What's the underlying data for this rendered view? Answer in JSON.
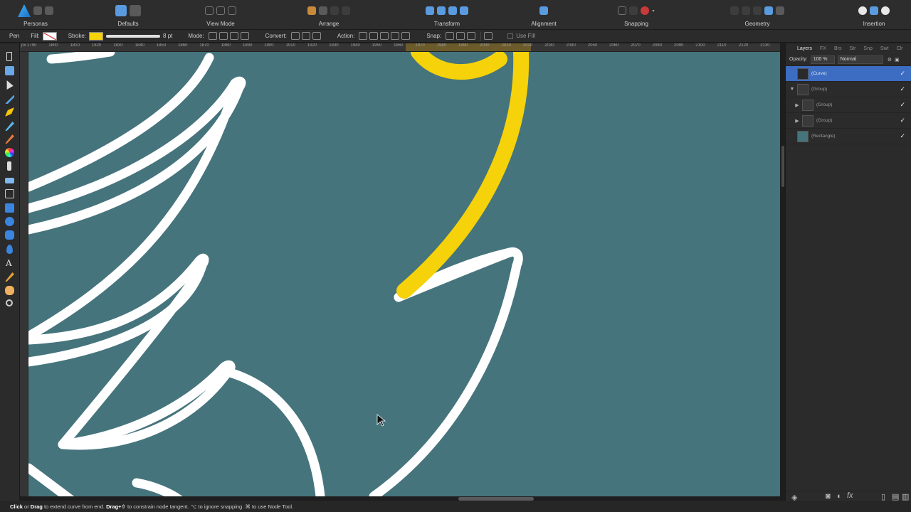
{
  "toolbar": {
    "personas_label": "Personas",
    "groups": [
      {
        "id": "defaults",
        "label": "Defaults"
      },
      {
        "id": "view-mode",
        "label": "View Mode"
      },
      {
        "id": "arrange",
        "label": "Arrange"
      },
      {
        "id": "transform",
        "label": "Transform"
      },
      {
        "id": "alignment",
        "label": "Alignment"
      },
      {
        "id": "snapping",
        "label": "Snapping"
      },
      {
        "id": "geometry",
        "label": "Geometry"
      },
      {
        "id": "insertion",
        "label": "Insertion"
      }
    ]
  },
  "context": {
    "tool_name": "Pen",
    "fill_label": "Fill:",
    "stroke_label": "Stroke:",
    "stroke_width": "8 pt",
    "mode_label": "Mode:",
    "convert_label": "Convert:",
    "action_label": "Action:",
    "snap_label": "Snap:",
    "use_fill_label": "Use Fill",
    "stroke_color": "#f5d20a"
  },
  "ruler": {
    "labels": [
      "1790",
      "1800",
      "1810",
      "1820",
      "1830",
      "1840",
      "1850",
      "1860",
      "1870",
      "1880",
      "1890",
      "1900",
      "1910",
      "1920",
      "1930",
      "1940",
      "1950",
      "1960",
      "1970",
      "1980",
      "1990",
      "2000",
      "2010",
      "2020",
      "2030",
      "2040",
      "2050",
      "2060",
      "2070",
      "2080",
      "2090",
      "2100",
      "2110",
      "2120",
      "2130"
    ],
    "unit": "px"
  },
  "canvas": {
    "background_color": "#45747c",
    "stroke_color": "#ffffff",
    "curve_color": "#f5d20a"
  },
  "layers_panel": {
    "tabs": [
      "Layers",
      "FX",
      "Brs",
      "Str",
      "Snp",
      "Swt",
      "Clr"
    ],
    "opacity_label": "Opacity:",
    "opacity_value": "100 %",
    "blend_mode": "Normal",
    "layers": [
      {
        "name": "(Curve)",
        "selected": true,
        "expandable": false
      },
      {
        "name": "(Group)",
        "selected": false,
        "expandable": true,
        "expanded": true
      },
      {
        "name": "(Group)",
        "selected": false,
        "expandable": true,
        "expanded": false,
        "indent": 1
      },
      {
        "name": "(Group)",
        "selected": false,
        "expandable": true,
        "expanded": false,
        "indent": 1
      },
      {
        "name": "(Rectangle)",
        "selected": false,
        "expandable": false
      }
    ],
    "selection_color": "#3d6dc2"
  },
  "status": {
    "click": "Click",
    "or": " or ",
    "drag": "Drag",
    "part1": " to extend curve from end. ",
    "drag_shift": "Drag+⇧",
    "part2": " to constrain node tangent. ⌥ to ignore snapping. ⌘ to use Node Tool."
  }
}
